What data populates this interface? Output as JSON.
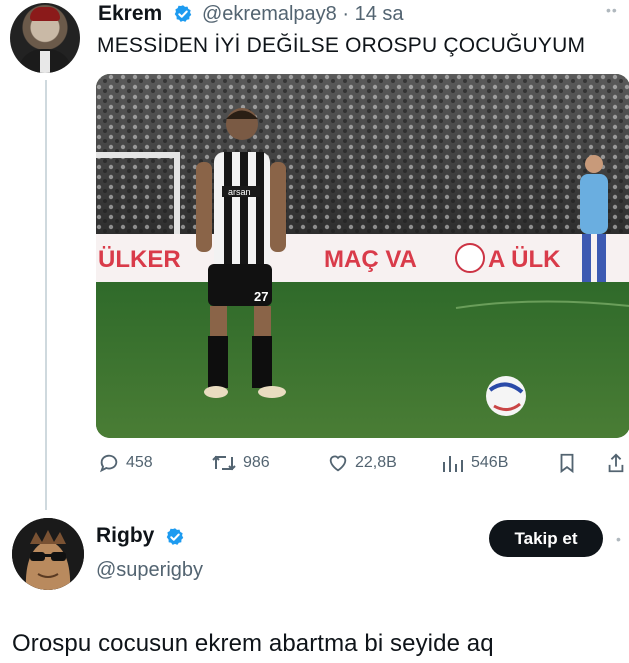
{
  "tweet": {
    "author_name": "Ekrem",
    "author_handle": "@ekremalpay8 · 14 sa",
    "text": "MESSİDEN İYİ DEĞİLSE OROSPU ÇOCUĞUYUM",
    "media": {
      "banner_left": "ÜLKER",
      "banner_center": "MAÇ VA",
      "banner_center2": "A ÜLK",
      "jersey_number": "27",
      "jersey_sponsor": "arsan"
    },
    "actions": {
      "replies": "458",
      "retweets": "986",
      "likes": "22,8B",
      "views": "546B"
    }
  },
  "reply": {
    "author_name": "Rigby",
    "author_handle": "@superigby",
    "follow_label": "Takip et",
    "text": "Orospu cocusun ekrem abartma bi seyide aq"
  },
  "colors": {
    "verified": "#1d9bf0",
    "secondary_text": "#536471",
    "primary_text": "#0f1419",
    "follow_bg": "#0f1419"
  },
  "icons": [
    "reply-icon",
    "retweet-icon",
    "like-icon",
    "views-icon",
    "bookmark-icon",
    "share-icon",
    "verified-icon",
    "more-icon"
  ]
}
